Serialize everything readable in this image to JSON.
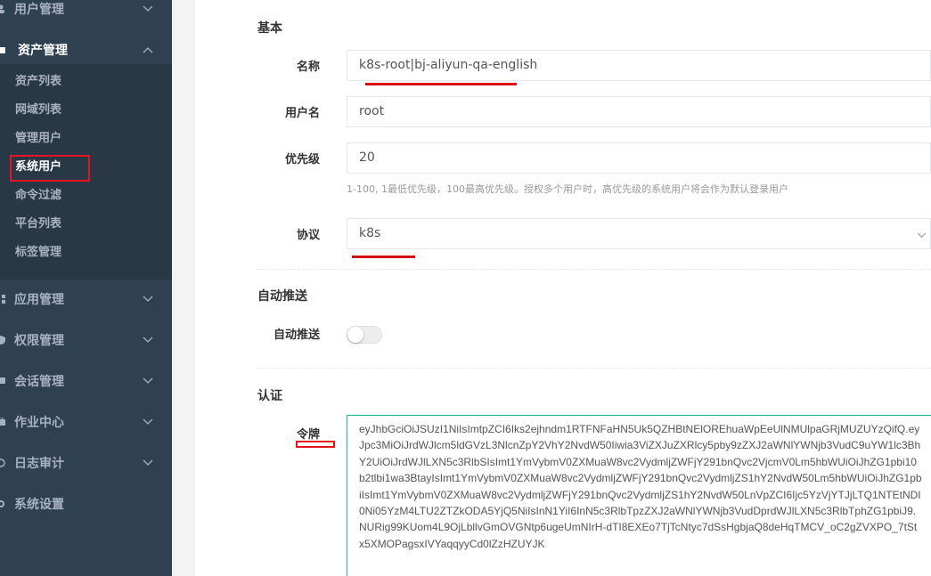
{
  "sidebar": {
    "menus": [
      {
        "label": "用户管理",
        "icon": "user-icon"
      },
      {
        "label": "资产管理",
        "icon": "asset-icon",
        "active": true
      },
      {
        "label": "应用管理",
        "icon": "app-icon"
      },
      {
        "label": "权限管理",
        "icon": "permission-icon"
      },
      {
        "label": "会话管理",
        "icon": "session-icon"
      },
      {
        "label": "作业中心",
        "icon": "job-icon"
      },
      {
        "label": "日志审计",
        "icon": "log-icon"
      },
      {
        "label": "系统设置",
        "icon": "settings-icon"
      }
    ],
    "asset_submenu": [
      "资产列表",
      "网域列表",
      "管理用户",
      "系统用户",
      "命令过滤",
      "平台列表",
      "标签管理"
    ]
  },
  "form": {
    "basic": {
      "title": "基本",
      "name_label": "名称",
      "name_value": "k8s-root|bj-aliyun-qa-english",
      "username_label": "用户名",
      "username_value": "root",
      "priority_label": "优先级",
      "priority_value": "20",
      "priority_help": "1-100, 1最低优先级，100最高优先级。授权多个用户时，高优先级的系统用户将会作为默认登录用户",
      "protocol_label": "协议",
      "protocol_value": "k8s"
    },
    "auto_push": {
      "title": "自动推送",
      "label": "自动推送",
      "enabled": false
    },
    "auth": {
      "title": "认证",
      "token_label": "令牌",
      "token_value": "eyJhbGciOiJSUzI1NiIsImtpZCI6Iks2ejhndm1RTFNFaHN5Uk5QZHBtNElOREhuaWpEeUlNMUlpaGRjMUZUYzQifQ.eyJpc3MiOiJrdWJlcm5ldGVzL3NlcnZpY2VhY2NvdW50Iiwia3ViZXJuZXRlcy5pby9zZXJ2aWNlYWNjb3VudC9uYW1lc3BhY2UiOiJrdWJlLXN5c3RlbSIsImt1YmVybmV0ZXMuaW8vc2VydmljZWFjY291bnQvc2VjcmV0Lm5hbWUiOiJhZG1pbi10b2tlbi1wa3BtayIsImt1YmVybmV0ZXMuaW8vc2VydmljZWFjY291bnQvc2VydmljZS1hY2NvdW50Lm5hbWUiOiJhZG1pbiIsImt1YmVybmV0ZXMuaW8vc2VydmljZWFjY291bnQvc2VydmljZS1hY2NvdW50LnVpZCI6Ijc5YzVjYTJjLTQ1NTEtNDI0Ni05YzM4LTU2ZTZkODA5YjQ5NiIsInN1YiI6InN5c3RlbTpzZXJ2aWNlYWNjb3VudDprdWJlLXN5c3RlbTphZG1pbiJ9.NURig99KUom4L9OjLbllvGmOVGNtp6ugeUmNIrH-dTI8EXEo7TjTcNtyc7dSsHgbjaQ8deHqTMCV_oC2gZVXPO_7tStx5XMOPagsxIVYaqqyyCd0lZzHZUYJK"
    }
  }
}
